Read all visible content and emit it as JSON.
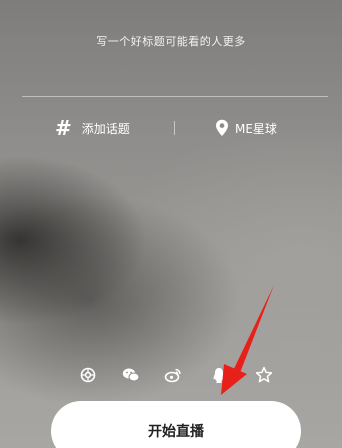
{
  "title_hint": "写一个好标题可能看的人更多",
  "options": {
    "topic_label": "添加话题",
    "topic_icon": "hash-icon",
    "location_label": "ME星球",
    "location_icon": "location-pin-icon"
  },
  "share": [
    {
      "icon": "moments-icon"
    },
    {
      "icon": "wechat-icon"
    },
    {
      "icon": "weibo-icon"
    },
    {
      "icon": "qq-icon"
    },
    {
      "icon": "qzone-star-icon"
    }
  ],
  "start_button": {
    "label": "开始直播"
  },
  "colors": {
    "arrow": "#e8201a",
    "text": "#ffffff",
    "button_bg": "#ffffff"
  }
}
